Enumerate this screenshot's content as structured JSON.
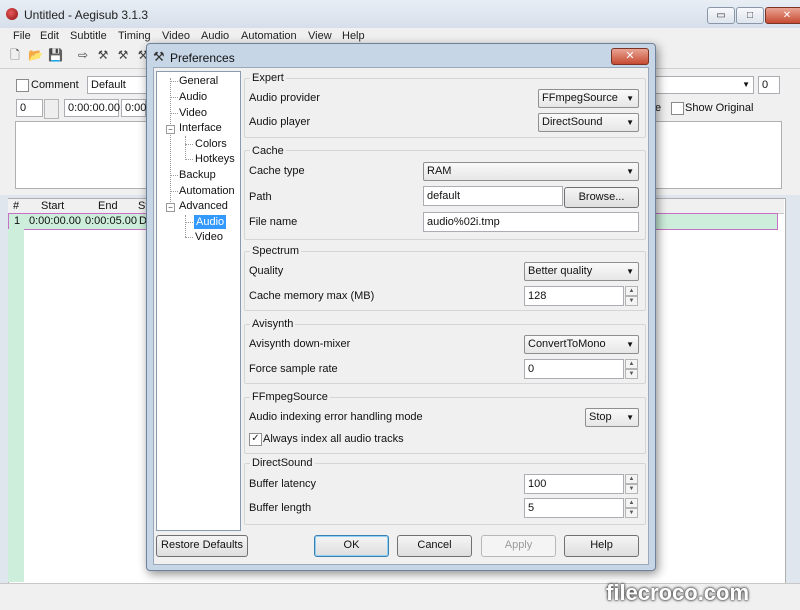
{
  "main": {
    "title": "Untitled - Aegisub 3.1.3",
    "window_controls": {
      "minimize": "▭",
      "maximize": "□",
      "close": "✕"
    },
    "menu": [
      "File",
      "Edit",
      "Subtitle",
      "Timing",
      "Video",
      "Audio",
      "Automation",
      "View",
      "Help"
    ],
    "edit": {
      "comment_label": "Comment",
      "style_value": "Default",
      "layer_value": "0",
      "start_time": "0:00:00.00",
      "end_time": "0:00:",
      "right_number": "0",
      "time_label": "e",
      "show_original_label": "Show Original"
    },
    "grid": {
      "columns": [
        "#",
        "Start",
        "End",
        "St"
      ],
      "rows": [
        {
          "num": "1",
          "start": "0:00:00.00",
          "end": "0:00:05.00",
          "style": "D"
        }
      ]
    },
    "watermark": "filecroco.com"
  },
  "dialog": {
    "title": "Preferences",
    "close": "✕",
    "tree": {
      "general": "General",
      "audio": "Audio",
      "video": "Video",
      "interface": "Interface",
      "colors": "Colors",
      "hotkeys": "Hotkeys",
      "backup": "Backup",
      "automation": "Automation",
      "advanced": "Advanced",
      "adv_audio": "Audio",
      "adv_video": "Video",
      "expander": "−"
    },
    "expert": {
      "label": "Expert",
      "audio_provider_label": "Audio provider",
      "audio_provider_value": "FFmpegSource",
      "audio_player_label": "Audio player",
      "audio_player_value": "DirectSound"
    },
    "cache": {
      "label": "Cache",
      "type_label": "Cache type",
      "type_value": "RAM",
      "path_label": "Path",
      "path_value": "default",
      "browse_label": "Browse...",
      "file_name_label": "File name",
      "file_name_value": "audio%02i.tmp"
    },
    "spectrum": {
      "label": "Spectrum",
      "quality_label": "Quality",
      "quality_value": "Better quality",
      "cache_mem_label": "Cache memory max (MB)",
      "cache_mem_value": "128"
    },
    "avisynth": {
      "label": "Avisynth",
      "downmixer_label": "Avisynth down-mixer",
      "downmixer_value": "ConvertToMono",
      "sample_rate_label": "Force sample rate",
      "sample_rate_value": "0"
    },
    "ffmpeg": {
      "label": "FFmpegSource",
      "error_mode_label": "Audio indexing error handling mode",
      "error_mode_value": "Stop",
      "index_all_label": "Always index all audio tracks",
      "index_all_checked": true
    },
    "directsound": {
      "label": "DirectSound",
      "latency_label": "Buffer latency",
      "latency_value": "100",
      "length_label": "Buffer length",
      "length_value": "5"
    },
    "buttons": {
      "restore": "Restore Defaults",
      "ok": "OK",
      "cancel": "Cancel",
      "apply": "Apply",
      "help": "Help"
    },
    "glyphs": {
      "arrow": "▼",
      "up": "▲",
      "down": "▼",
      "check": "✓"
    }
  },
  "colors": {
    "accent": "#3399ff",
    "grid_highlight": "#cdeedb",
    "close_red": "#c64a32"
  }
}
